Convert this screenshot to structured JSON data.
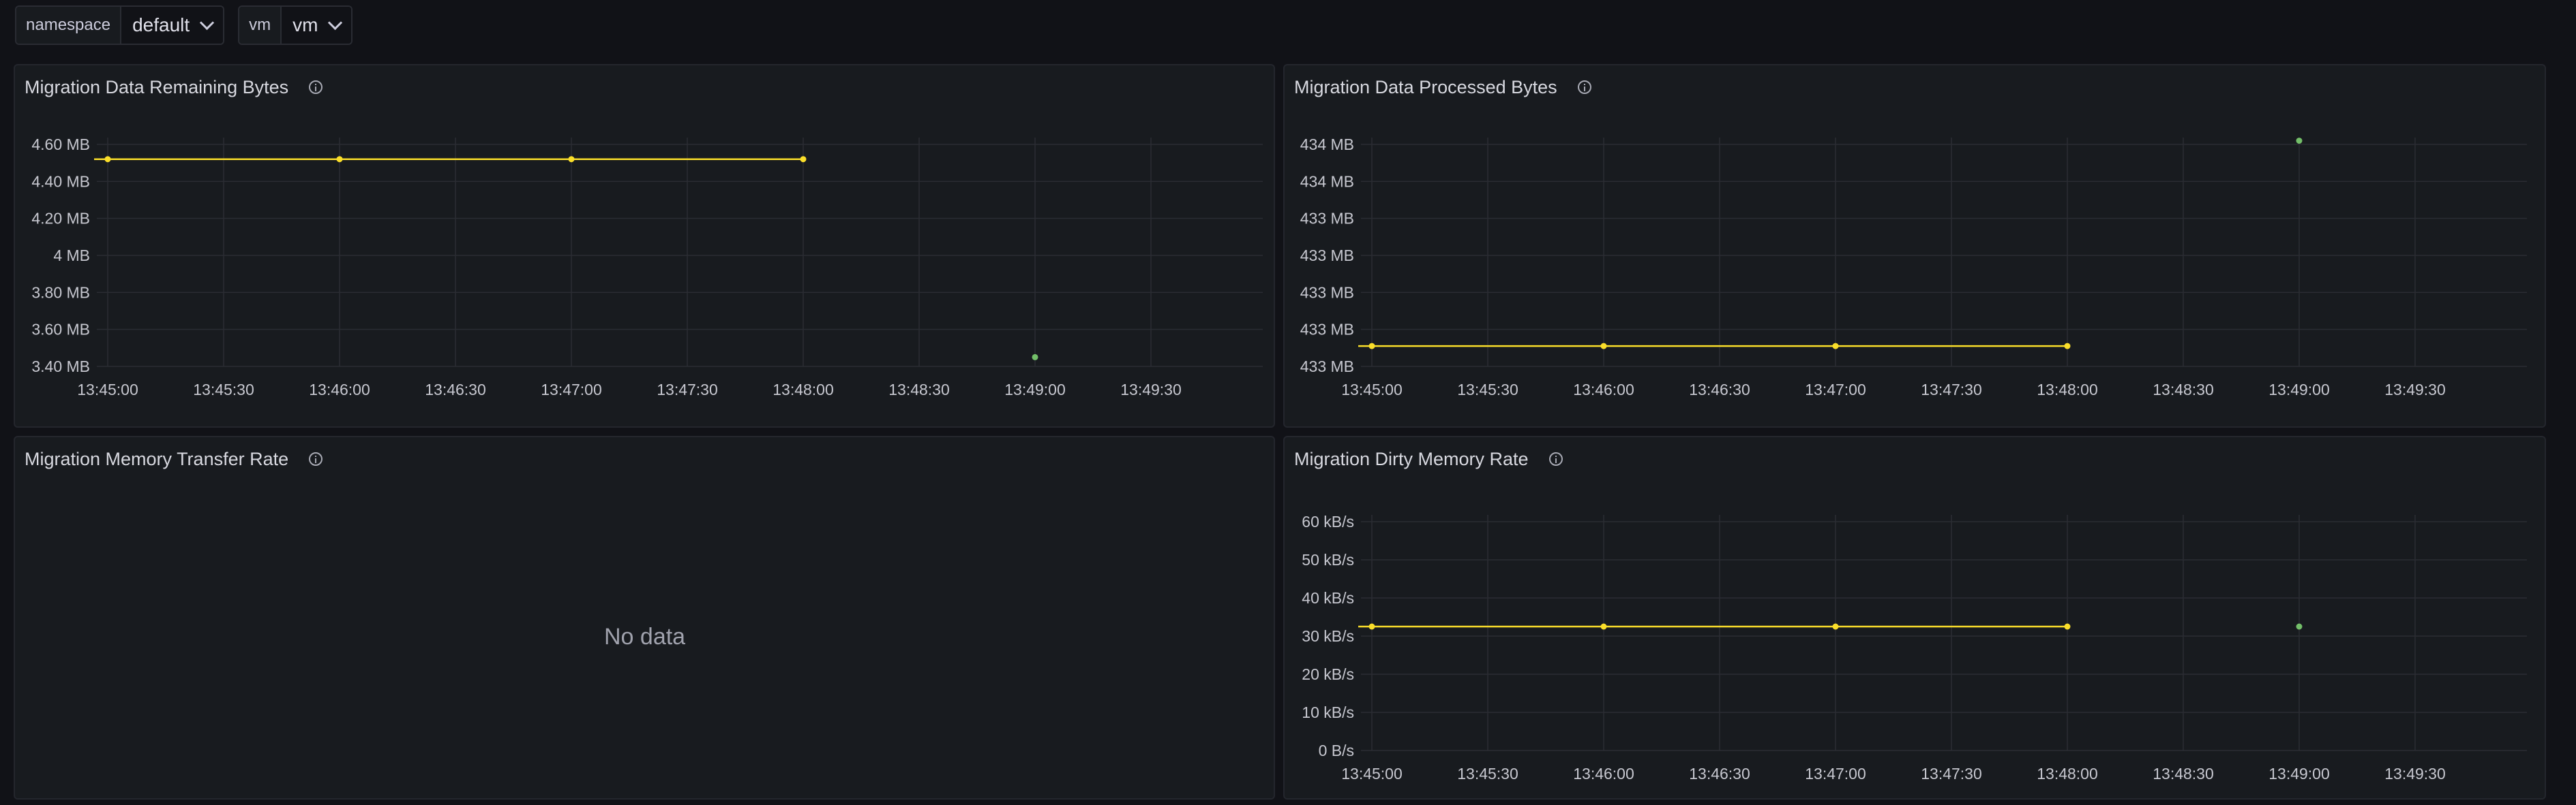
{
  "variables": [
    {
      "label": "namespace",
      "value": "default"
    },
    {
      "label": "vm",
      "value": "vm"
    }
  ],
  "panels": {
    "remaining": {
      "title": "Migration Data Remaining Bytes"
    },
    "processed": {
      "title": "Migration Data Processed Bytes"
    },
    "transfer": {
      "title": "Migration Memory Transfer Rate",
      "no_data": "No data"
    },
    "dirty": {
      "title": "Migration Dirty Memory Rate"
    }
  },
  "colors": {
    "series_main": "#fade2a",
    "series_alt": "#73bf69",
    "background": "#111217",
    "panel": "#181b1f"
  },
  "chart_data": [
    {
      "id": "remaining",
      "type": "line",
      "title": "Migration Data Remaining Bytes",
      "x_ticks": [
        "13:45:00",
        "13:45:30",
        "13:46:00",
        "13:46:30",
        "13:47:00",
        "13:47:30",
        "13:48:00",
        "13:48:30",
        "13:49:00",
        "13:49:30"
      ],
      "y_ticks": [
        "3.40 MB",
        "3.60 MB",
        "3.80 MB",
        "4 MB",
        "4.20 MB",
        "4.40 MB",
        "4.60 MB"
      ],
      "series": [
        {
          "color": "#fade2a",
          "x": [
            "13:45:00",
            "13:46:00",
            "13:47:00",
            "13:48:00"
          ],
          "values": [
            4.52,
            4.52,
            4.52,
            4.52
          ]
        },
        {
          "color": "#73bf69",
          "x": [
            "13:49:00"
          ],
          "values": [
            3.45
          ]
        }
      ]
    },
    {
      "id": "processed",
      "type": "line",
      "title": "Migration Data Processed Bytes",
      "x_ticks": [
        "13:45:00",
        "13:45:30",
        "13:46:00",
        "13:46:30",
        "13:47:00",
        "13:47:30",
        "13:48:00",
        "13:48:30",
        "13:49:00",
        "13:49:30"
      ],
      "y_ticks": [
        "433 MB",
        "433 MB",
        "433 MB",
        "433 MB",
        "433 MB",
        "434 MB",
        "434 MB"
      ],
      "series": [
        {
          "color": "#fade2a",
          "x": [
            "13:45:00",
            "13:46:00",
            "13:47:00",
            "13:48:00"
          ],
          "values": [
            0.55,
            0.55,
            0.55,
            0.55
          ]
        },
        {
          "color": "#73bf69",
          "x": [
            "13:49:00"
          ],
          "values": [
            6.1
          ]
        }
      ]
    },
    {
      "id": "dirty",
      "type": "line",
      "title": "Migration Dirty Memory Rate",
      "x_ticks": [
        "13:45:00",
        "13:45:30",
        "13:46:00",
        "13:46:30",
        "13:47:00",
        "13:47:30",
        "13:48:00",
        "13:48:30",
        "13:49:00",
        "13:49:30"
      ],
      "y_ticks": [
        "0 B/s",
        "10 kB/s",
        "20 kB/s",
        "30 kB/s",
        "40 kB/s",
        "50 kB/s",
        "60 kB/s"
      ],
      "series": [
        {
          "color": "#fade2a",
          "x": [
            "13:45:00",
            "13:46:00",
            "13:47:00",
            "13:48:00"
          ],
          "values": [
            32.5,
            32.5,
            32.5,
            32.5
          ]
        },
        {
          "color": "#73bf69",
          "x": [
            "13:49:00"
          ],
          "values": [
            32.5
          ]
        }
      ]
    }
  ]
}
